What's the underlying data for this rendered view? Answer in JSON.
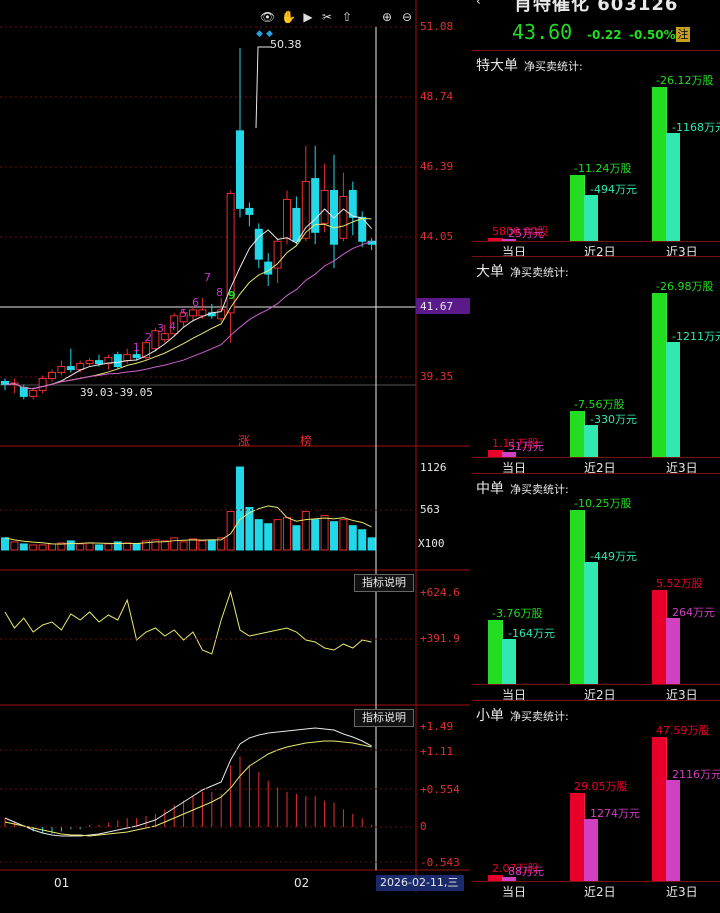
{
  "toolbar": {
    "icons": [
      "eye-icon",
      "hand-icon",
      "play-icon",
      "scissors-icon",
      "export-icon",
      "zoom-in-icon",
      "zoom-out-icon"
    ]
  },
  "main_chart": {
    "y_ticks": [
      "51.08",
      "48.74",
      "46.39",
      "44.05",
      "41.67",
      "39.35"
    ],
    "current_price_tag": "41.67",
    "high_annotation": "50.38",
    "low_annotation": "39.03-39.05",
    "markers": [
      "涨",
      "榜"
    ],
    "td_counts": [
      "1",
      "2",
      "3",
      "4",
      "5",
      "6",
      "7",
      "8",
      "9"
    ]
  },
  "volume_chart": {
    "y_ticks": [
      "1126",
      "563",
      "X100"
    ]
  },
  "indicator1": {
    "button": "指标说明",
    "y_ticks": [
      "+624.6",
      "+391.9"
    ]
  },
  "indicator2": {
    "button": "指标说明",
    "y_ticks": [
      "+1.49",
      "+1.11",
      "+0.554",
      "0",
      "-0.543"
    ]
  },
  "x_axis": {
    "labels": [
      "01",
      "02"
    ],
    "cursor_date": "2026-02-11,三"
  },
  "stock": {
    "title": "肖特催化 603126",
    "price": "43.60",
    "change": "-0.22",
    "change_pct": "-0.50%",
    "badge": "注"
  },
  "sections": [
    {
      "title": "特大单",
      "subtitle": "净买卖统计:",
      "days": [
        "当日",
        "近2日",
        "近3日"
      ],
      "shares": [
        "5800.00股",
        "-11.24万股",
        "-26.12万股"
      ],
      "amounts": [
        "25万元",
        "-494万元",
        "-1168万元"
      ],
      "values": [
        0.58,
        -11.24,
        -26.12
      ],
      "colors": [
        "#e8002a",
        "#22dd22",
        "#22dd22"
      ]
    },
    {
      "title": "大单",
      "subtitle": "净买卖统计:",
      "days": [
        "当日",
        "近2日",
        "近3日"
      ],
      "shares": [
        "1.11万股",
        "-7.56万股",
        "-26.98万股"
      ],
      "amounts": [
        "51万元",
        "-330万元",
        "-1211万元"
      ],
      "values": [
        1.11,
        -7.56,
        -26.98
      ],
      "colors": [
        "#e8002a",
        "#22dd22",
        "#22dd22"
      ]
    },
    {
      "title": "中单",
      "subtitle": "净买卖统计:",
      "days": [
        "当日",
        "近2日",
        "近3日"
      ],
      "shares": [
        "-3.76万股",
        "-10.25万股",
        "5.52万股"
      ],
      "amounts": [
        "-164万元",
        "-449万元",
        "264万元"
      ],
      "values": [
        -3.76,
        -10.25,
        5.52
      ],
      "colors": [
        "#22dd22",
        "#22dd22",
        "#e8002a"
      ]
    },
    {
      "title": "小单",
      "subtitle": "净买卖统计:",
      "days": [
        "当日",
        "近2日",
        "近3日"
      ],
      "shares": [
        "2.07万股",
        "29.05万股",
        "47.59万股"
      ],
      "amounts": [
        "88万元",
        "1274万元",
        "2116万元"
      ],
      "values": [
        2.07,
        29.05,
        47.59
      ],
      "colors": [
        "#e8002a",
        "#e8002a",
        "#e8002a"
      ]
    }
  ],
  "candles": [
    {
      "o": 39.2,
      "c": 39.1,
      "h": 39.3,
      "l": 38.9
    },
    {
      "o": 39.1,
      "c": 39.15,
      "h": 39.3,
      "l": 38.8
    },
    {
      "o": 39.0,
      "c": 38.7,
      "h": 39.1,
      "l": 38.6
    },
    {
      "o": 38.7,
      "c": 38.9,
      "h": 39.0,
      "l": 38.6
    },
    {
      "o": 38.9,
      "c": 39.3,
      "h": 39.4,
      "l": 38.8
    },
    {
      "o": 39.3,
      "c": 39.5,
      "h": 39.6,
      "l": 39.2
    },
    {
      "o": 39.5,
      "c": 39.7,
      "h": 39.9,
      "l": 39.4
    },
    {
      "o": 39.7,
      "c": 39.6,
      "h": 40.3,
      "l": 39.5
    },
    {
      "o": 39.6,
      "c": 39.8,
      "h": 39.9,
      "l": 39.5
    },
    {
      "o": 39.8,
      "c": 39.9,
      "h": 40.0,
      "l": 39.7
    },
    {
      "o": 39.9,
      "c": 39.8,
      "h": 40.1,
      "l": 39.7
    },
    {
      "o": 39.8,
      "c": 40.0,
      "h": 40.1,
      "l": 39.6
    },
    {
      "o": 40.1,
      "c": 39.7,
      "h": 40.2,
      "l": 39.6
    },
    {
      "o": 39.9,
      "c": 40.1,
      "h": 40.3,
      "l": 39.8
    },
    {
      "o": 40.1,
      "c": 40.0,
      "h": 40.4,
      "l": 39.9
    },
    {
      "o": 40.0,
      "c": 40.5,
      "h": 40.6,
      "l": 39.9
    },
    {
      "o": 40.3,
      "c": 40.9,
      "h": 41.0,
      "l": 40.2
    },
    {
      "o": 40.6,
      "c": 40.8,
      "h": 41.1,
      "l": 40.5
    },
    {
      "o": 40.8,
      "c": 41.4,
      "h": 41.5,
      "l": 40.7
    },
    {
      "o": 41.2,
      "c": 41.5,
      "h": 41.6,
      "l": 41.0
    },
    {
      "o": 41.4,
      "c": 41.6,
      "h": 41.7,
      "l": 41.2
    },
    {
      "o": 41.4,
      "c": 41.6,
      "h": 42.0,
      "l": 41.3
    },
    {
      "o": 41.5,
      "c": 41.4,
      "h": 41.8,
      "l": 41.3
    },
    {
      "o": 41.3,
      "c": 41.6,
      "h": 42.0,
      "l": 41.2
    },
    {
      "o": 41.5,
      "c": 45.5,
      "h": 45.6,
      "l": 40.5
    },
    {
      "o": 47.6,
      "c": 45.0,
      "h": 50.38,
      "l": 44.7
    },
    {
      "o": 45.0,
      "c": 44.8,
      "h": 45.2,
      "l": 44.4
    },
    {
      "o": 44.3,
      "c": 43.3,
      "h": 44.5,
      "l": 43.0
    },
    {
      "o": 43.2,
      "c": 42.8,
      "h": 43.5,
      "l": 42.4
    },
    {
      "o": 43.0,
      "c": 43.9,
      "h": 44.0,
      "l": 42.5
    },
    {
      "o": 44.0,
      "c": 45.3,
      "h": 45.6,
      "l": 43.8
    },
    {
      "o": 45.0,
      "c": 43.9,
      "h": 45.4,
      "l": 43.8
    },
    {
      "o": 44.0,
      "c": 45.9,
      "h": 47.1,
      "l": 43.9
    },
    {
      "o": 46.0,
      "c": 44.2,
      "h": 47.1,
      "l": 43.8
    },
    {
      "o": 44.5,
      "c": 45.6,
      "h": 46.5,
      "l": 44.2
    },
    {
      "o": 45.6,
      "c": 43.8,
      "h": 46.8,
      "l": 43.0
    },
    {
      "o": 44.0,
      "c": 45.4,
      "h": 46.2,
      "l": 43.9
    },
    {
      "o": 45.6,
      "c": 44.7,
      "h": 45.9,
      "l": 44.1
    },
    {
      "o": 44.7,
      "c": 43.9,
      "h": 44.9,
      "l": 43.7
    },
    {
      "o": 43.9,
      "c": 43.8,
      "h": 44.0,
      "l": 43.6
    }
  ]
}
